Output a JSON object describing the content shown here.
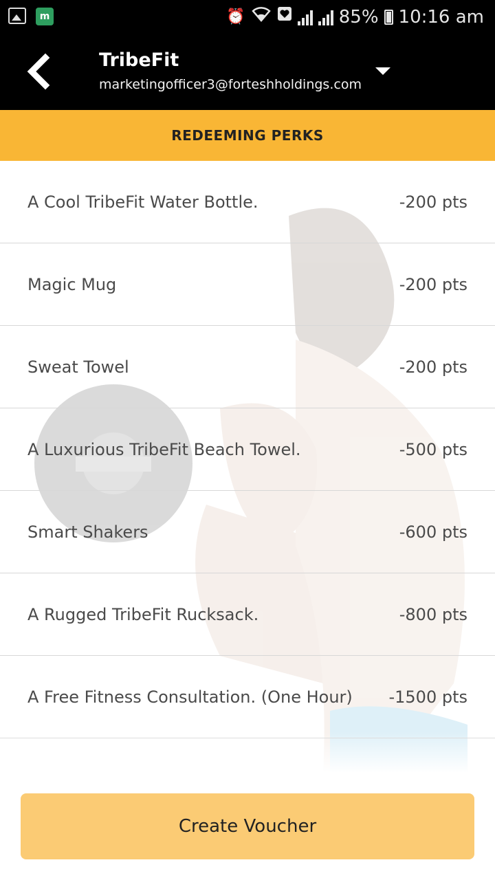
{
  "status_bar": {
    "battery": "85%",
    "time": "10:16 am",
    "icons": [
      "image-icon",
      "m-app-icon",
      "alarm-icon",
      "wifi-icon",
      "notification-icon",
      "signal-icon",
      "battery-icon"
    ]
  },
  "header": {
    "app_name": "TribeFit",
    "account_email": "marketingofficer3@forteshholdings.com",
    "back_icon": "chevron-left-icon",
    "dropdown_icon": "triangle-down-icon"
  },
  "banner": {
    "title": "REDEEMING PERKS"
  },
  "perks": [
    {
      "name": "A Cool TribeFit Water Bottle.",
      "points": "-200 pts"
    },
    {
      "name": "Magic Mug",
      "points": "-200 pts"
    },
    {
      "name": "Sweat Towel",
      "points": "-200 pts"
    },
    {
      "name": "A Luxurious TribeFit Beach Towel.",
      "points": "-500 pts"
    },
    {
      "name": "Smart Shakers",
      "points": "-600 pts"
    },
    {
      "name": "A Rugged TribeFit Rucksack.",
      "points": "-800 pts"
    },
    {
      "name": "A Free Fitness Consultation. (One Hour)",
      "points": "-1500 pts"
    }
  ],
  "footer": {
    "create_voucher_label": "Create Voucher"
  },
  "colors": {
    "header_bg": "#000000",
    "banner_bg": "#f9b635",
    "button_bg": "#fbcb74",
    "text": "#4a4a4a"
  }
}
